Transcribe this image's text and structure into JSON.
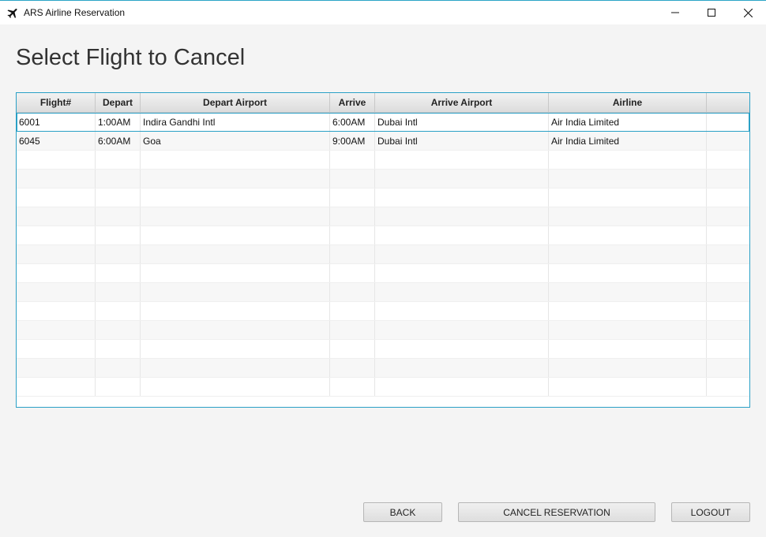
{
  "window": {
    "title": "ARS Airline Reservation"
  },
  "page": {
    "title": "Select Flight to Cancel"
  },
  "table": {
    "columns": [
      "Flight#",
      "Depart",
      "Depart Airport",
      "Arrive",
      "Arrive Airport",
      "Airline",
      ""
    ],
    "rows": [
      [
        "6001",
        "1:00AM",
        "Indira Gandhi Intl",
        "6:00AM",
        "Dubai Intl",
        "Air India Limited",
        ""
      ],
      [
        "6045",
        "6:00AM",
        "Goa",
        "9:00AM",
        "Dubai Intl",
        "Air India Limited",
        ""
      ]
    ],
    "selected_row": 0
  },
  "buttons": {
    "back": "BACK",
    "cancel_reservation": "CANCEL RESERVATION",
    "logout": "LOGOUT"
  },
  "colors": {
    "accent": "#2aa0c6",
    "background": "#f4f4f4"
  },
  "icons": {
    "app": "airplane-icon",
    "minimize": "minimize-icon",
    "maximize": "maximize-icon",
    "close": "close-icon"
  }
}
